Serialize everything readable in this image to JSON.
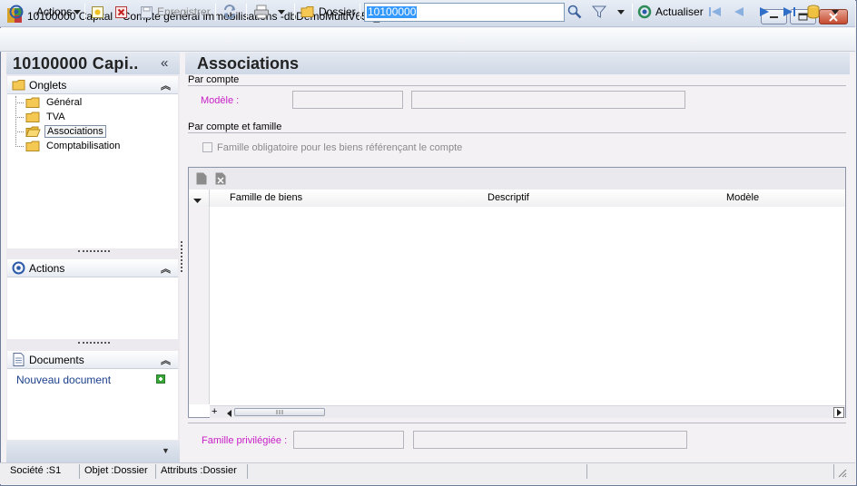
{
  "window": {
    "title": "10100000 Capital -  Compte général immobilisations -dbDemoMultiV650_Prod-"
  },
  "toolbar": {
    "actions_label": "Actions",
    "save_label": "Enregistrer",
    "folder_label": "Dossier",
    "search_value": "10100000",
    "refresh_label": "Actualiser"
  },
  "left_pane": {
    "title": "10100000 Capi..",
    "collapse_glyph": "«",
    "onglets": {
      "label": "Onglets",
      "items": [
        {
          "label": "Général"
        },
        {
          "label": "TVA"
        },
        {
          "label": "Associations",
          "selected": true
        },
        {
          "label": "Comptabilisation"
        }
      ]
    },
    "actions": {
      "label": "Actions"
    },
    "documents": {
      "label": "Documents",
      "new_document": "Nouveau document"
    }
  },
  "main": {
    "title": "Associations",
    "par_compte": {
      "group_label": "Par compte",
      "model_label": "Modèle :"
    },
    "par_compte_famille": {
      "group_label": "Par compte et famille",
      "checkbox_label": "Famille obligatoire pour les biens référençant le compte",
      "checked": false
    },
    "grid": {
      "columns": [
        "Famille de biens",
        "Descriptif",
        "Modèle"
      ],
      "rows": []
    },
    "famille_privilegiee_label": "Famille privilégiée :"
  },
  "statusbar": {
    "societe": "Société :S1",
    "objet": "Objet :Dossier",
    "attributs": "Attributs :Dossier"
  },
  "colors": {
    "accent_label": "#c61ec6",
    "link": "#1b3f8b",
    "selection": "#3399ff"
  }
}
